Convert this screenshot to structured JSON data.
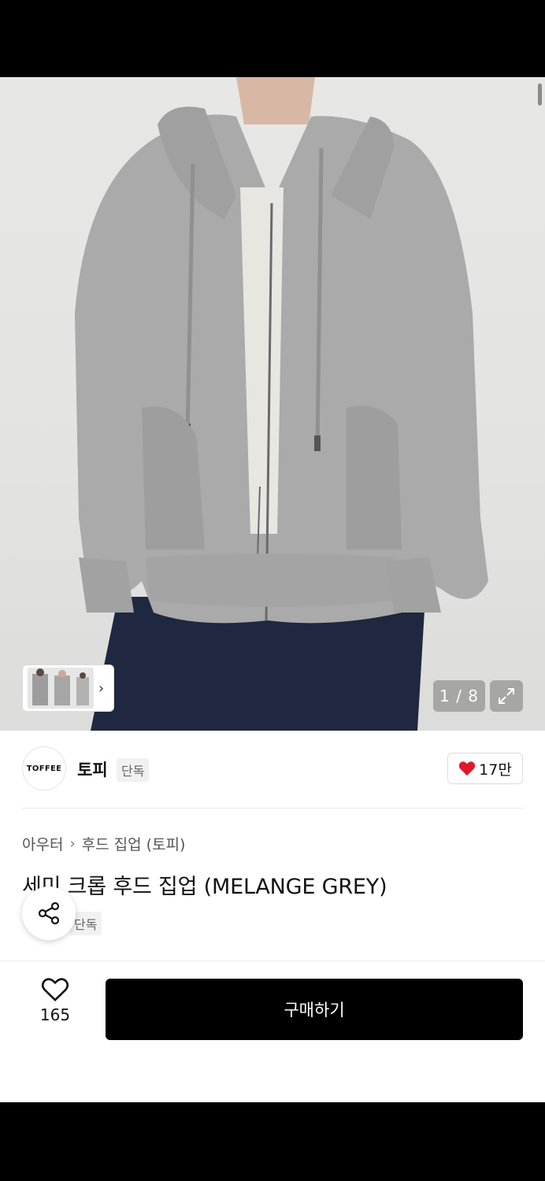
{
  "gallery": {
    "counter": "1 / 8",
    "thumb_arrow": "›"
  },
  "brand": {
    "logo_text": "TOFFEE",
    "name": "토피",
    "badge": "단독",
    "like_count": "17만"
  },
  "breadcrumb": {
    "category": "아우터",
    "separator": "›",
    "subcategory": "후드 집업 (토피)"
  },
  "product": {
    "title": "세미 크롭 후드 집업 (MELANGE GREY)",
    "exclusive_badge": "단독"
  },
  "bottom_bar": {
    "wish_count": "165",
    "buy_label": "구매하기"
  },
  "icons": [
    "heart-icon",
    "share-icon",
    "expand-icon",
    "chevron-right-icon"
  ],
  "colors": {
    "heart": "#e0182d",
    "buy_button": "#000000"
  }
}
